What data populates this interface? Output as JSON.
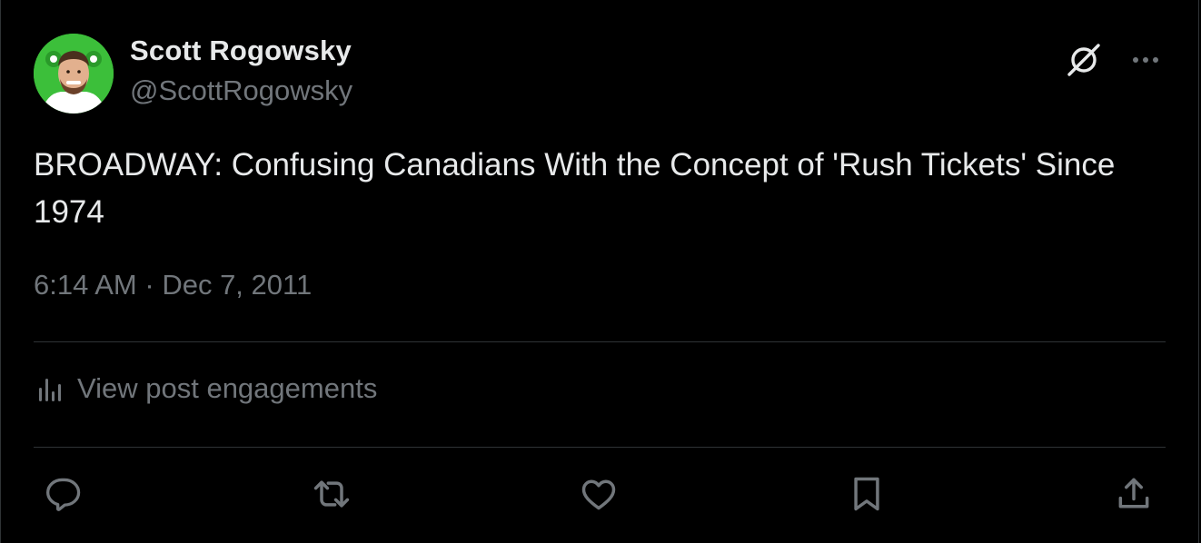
{
  "author": {
    "display_name": "Scott Rogowsky",
    "handle": "@ScottRogowsky"
  },
  "tweet": {
    "text": "BROADWAY: Confusing Canadians With the Concept of 'Rush Tickets' Since 1974",
    "time": "6:14 AM",
    "separator": "·",
    "date": "Dec 7, 2011"
  },
  "engagements": {
    "label": "View post engagements"
  },
  "icons": {
    "header": [
      "grok-icon",
      "more-icon"
    ],
    "engagements": "analytics-icon",
    "actions": [
      "reply-icon",
      "retweet-icon",
      "like-icon",
      "bookmark-icon",
      "share-icon"
    ]
  },
  "colors": {
    "background": "#000000",
    "primary_text": "#e7e9ea",
    "secondary_text": "#71767b",
    "divider": "#2f3336",
    "avatar_bg": "#3cbf3a"
  }
}
